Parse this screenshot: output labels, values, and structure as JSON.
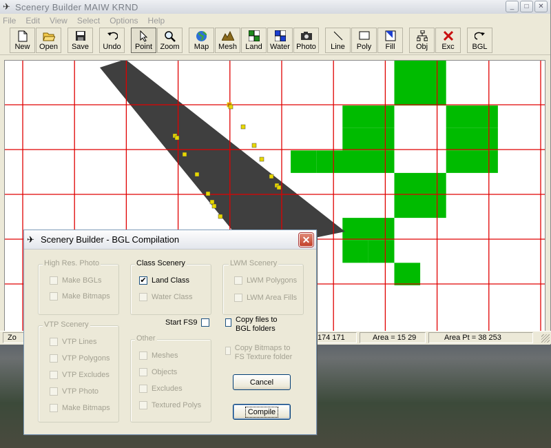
{
  "app": {
    "title": "Scenery Builder  MAIW KRND",
    "window_controls": {
      "minimize": "_",
      "maximize": "□",
      "close": "✕"
    }
  },
  "menu": [
    "File",
    "Edit",
    "View",
    "Select",
    "Options",
    "Help"
  ],
  "toolbar": [
    {
      "id": "new",
      "label": "New",
      "icon": "new-file-icon"
    },
    {
      "id": "open",
      "label": "Open",
      "icon": "open-folder-icon"
    },
    {
      "id": "save",
      "label": "Save",
      "icon": "save-disk-icon"
    },
    {
      "id": "undo",
      "label": "Undo",
      "icon": "undo-arrow-icon"
    },
    {
      "id": "point",
      "label": "Point",
      "icon": "pointer-arrow-icon",
      "active": true
    },
    {
      "id": "zoom",
      "label": "Zoom",
      "icon": "magnifier-icon"
    },
    {
      "id": "map",
      "label": "Map",
      "icon": "globe-icon"
    },
    {
      "id": "mesh",
      "label": "Mesh",
      "icon": "terrain-mesh-icon"
    },
    {
      "id": "land",
      "label": "Land",
      "icon": "land-class-icon"
    },
    {
      "id": "water",
      "label": "Water",
      "icon": "water-class-icon"
    },
    {
      "id": "photo",
      "label": "Photo",
      "icon": "camera-icon"
    },
    {
      "id": "line",
      "label": "Line",
      "icon": "line-tool-icon"
    },
    {
      "id": "poly",
      "label": "Poly",
      "icon": "polygon-tool-icon"
    },
    {
      "id": "fill",
      "label": "Fill",
      "icon": "fill-tool-icon"
    },
    {
      "id": "obj",
      "label": "Obj",
      "icon": "object-tree-icon"
    },
    {
      "id": "exc",
      "label": "Exc",
      "icon": "exclude-x-icon"
    },
    {
      "id": "bgl",
      "label": "BGL",
      "icon": "compile-redo-icon"
    }
  ],
  "status_bar": {
    "left": "Zo",
    "coords": "174 171",
    "area": "Area = 15 29",
    "area_pt": "Area Pt = 38 253"
  },
  "colors": {
    "grid_line": "#e00000",
    "land_class_cell": "#00bb00",
    "polygon_fill": "#3f3f3f",
    "point_marker": "#e8d800",
    "selected_point": "#e07000"
  },
  "dialog": {
    "title": "Scenery Builder - BGL Compilation",
    "close": "✕",
    "groups": {
      "hires": {
        "label": "High Res. Photo",
        "items": [
          {
            "label": "Make BGLs",
            "checked": false,
            "enabled": false
          },
          {
            "label": "Make Bitmaps",
            "checked": false,
            "enabled": false
          }
        ]
      },
      "class": {
        "label": "Class Scenery",
        "items": [
          {
            "label": "Land Class",
            "checked": true,
            "enabled": true
          },
          {
            "label": "Water Class",
            "checked": false,
            "enabled": false
          }
        ]
      },
      "lwm": {
        "label": "LWM Scenery",
        "items": [
          {
            "label": "LWM Polygons",
            "checked": false,
            "enabled": false
          },
          {
            "label": "LWM Area Fills",
            "checked": false,
            "enabled": false
          }
        ]
      },
      "vtp": {
        "label": "VTP Scenery",
        "items": [
          {
            "label": "VTP Lines",
            "checked": false,
            "enabled": false
          },
          {
            "label": "VTP Polygons",
            "checked": false,
            "enabled": false
          },
          {
            "label": "VTP Excludes",
            "checked": false,
            "enabled": false
          },
          {
            "label": "VTP Photo",
            "checked": false,
            "enabled": false
          },
          {
            "label": "Make Bitmaps",
            "checked": false,
            "enabled": false
          }
        ]
      },
      "other": {
        "label": "Other",
        "items": [
          {
            "label": "Meshes",
            "checked": false,
            "enabled": false
          },
          {
            "label": "Objects",
            "checked": false,
            "enabled": false
          },
          {
            "label": "Excludes",
            "checked": false,
            "enabled": false
          },
          {
            "label": "Textured Polys",
            "checked": false,
            "enabled": false
          }
        ]
      }
    },
    "start_fs9": {
      "label": "Start FS9",
      "checked": false
    },
    "copy_files": {
      "label": "Copy files to BGL folders",
      "checked": false,
      "enabled": true
    },
    "copy_bitmaps": {
      "label": "Copy Bitmaps to FS Texture folder",
      "checked": false,
      "enabled": false
    },
    "cancel_label": "Cancel",
    "compile_label": "Compile"
  }
}
